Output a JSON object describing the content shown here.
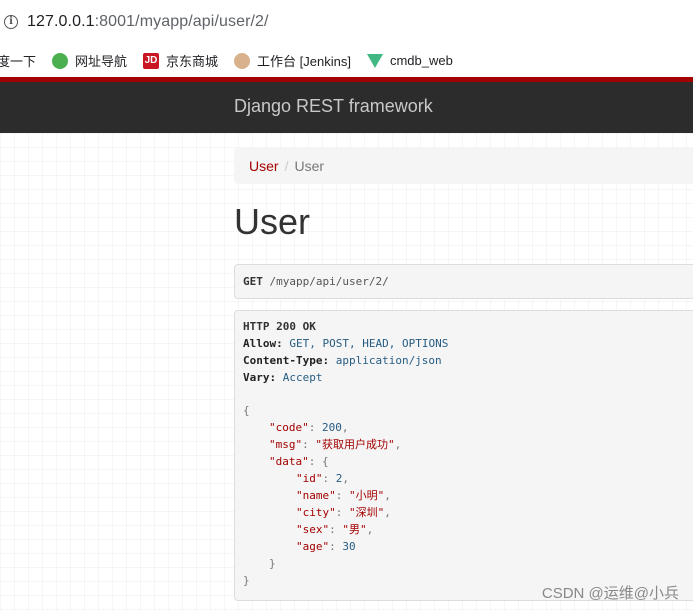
{
  "browser": {
    "url_host": "127.0.0.1",
    "url_rest": ":8001/myapp/api/user/2/",
    "info_icon": "i"
  },
  "bookmarks": [
    {
      "label": "度一下",
      "icon": "baidu-icon"
    },
    {
      "label": "网址导航",
      "icon": "nav-icon"
    },
    {
      "label": "京东商城",
      "icon": "jd-icon",
      "glyph": "JD"
    },
    {
      "label": "工作台 [Jenkins]",
      "icon": "jenkins-icon"
    },
    {
      "label": "cmdb_web",
      "icon": "vue-icon"
    }
  ],
  "navbar": {
    "brand": "Django REST framework"
  },
  "breadcrumb": {
    "link": "User",
    "separator": "/",
    "active": "User"
  },
  "page": {
    "title": "User"
  },
  "request": {
    "method": "GET",
    "path": " /myapp/api/user/2/"
  },
  "response": {
    "status": "HTTP 200 OK",
    "headers": [
      {
        "key": "Allow:",
        "value": " GET, POST, HEAD, OPTIONS"
      },
      {
        "key": "Content-Type:",
        "value": " application/json"
      },
      {
        "key": "Vary:",
        "value": " Accept"
      }
    ],
    "body": {
      "open_brace": "{",
      "close_brace": "}",
      "code_key": "\"code\"",
      "code_val": "200",
      "msg_key": "\"msg\"",
      "msg_val": "\"获取用户成功\"",
      "data_key": "\"data\"",
      "data_open": "{",
      "data_close": "}",
      "id_key": "\"id\"",
      "id_val": "2",
      "name_key": "\"name\"",
      "name_val": "\"小明\"",
      "city_key": "\"city\"",
      "city_val": "\"深圳\"",
      "sex_key": "\"sex\"",
      "sex_val": "\"男\"",
      "age_key": "\"age\"",
      "age_val": "30"
    }
  },
  "watermark": "CSDN @运维@小兵",
  "colors": {
    "brand_red": "#a30000",
    "navbar_bg": "#2c2c2c",
    "header_value_blue": "#265c83"
  }
}
